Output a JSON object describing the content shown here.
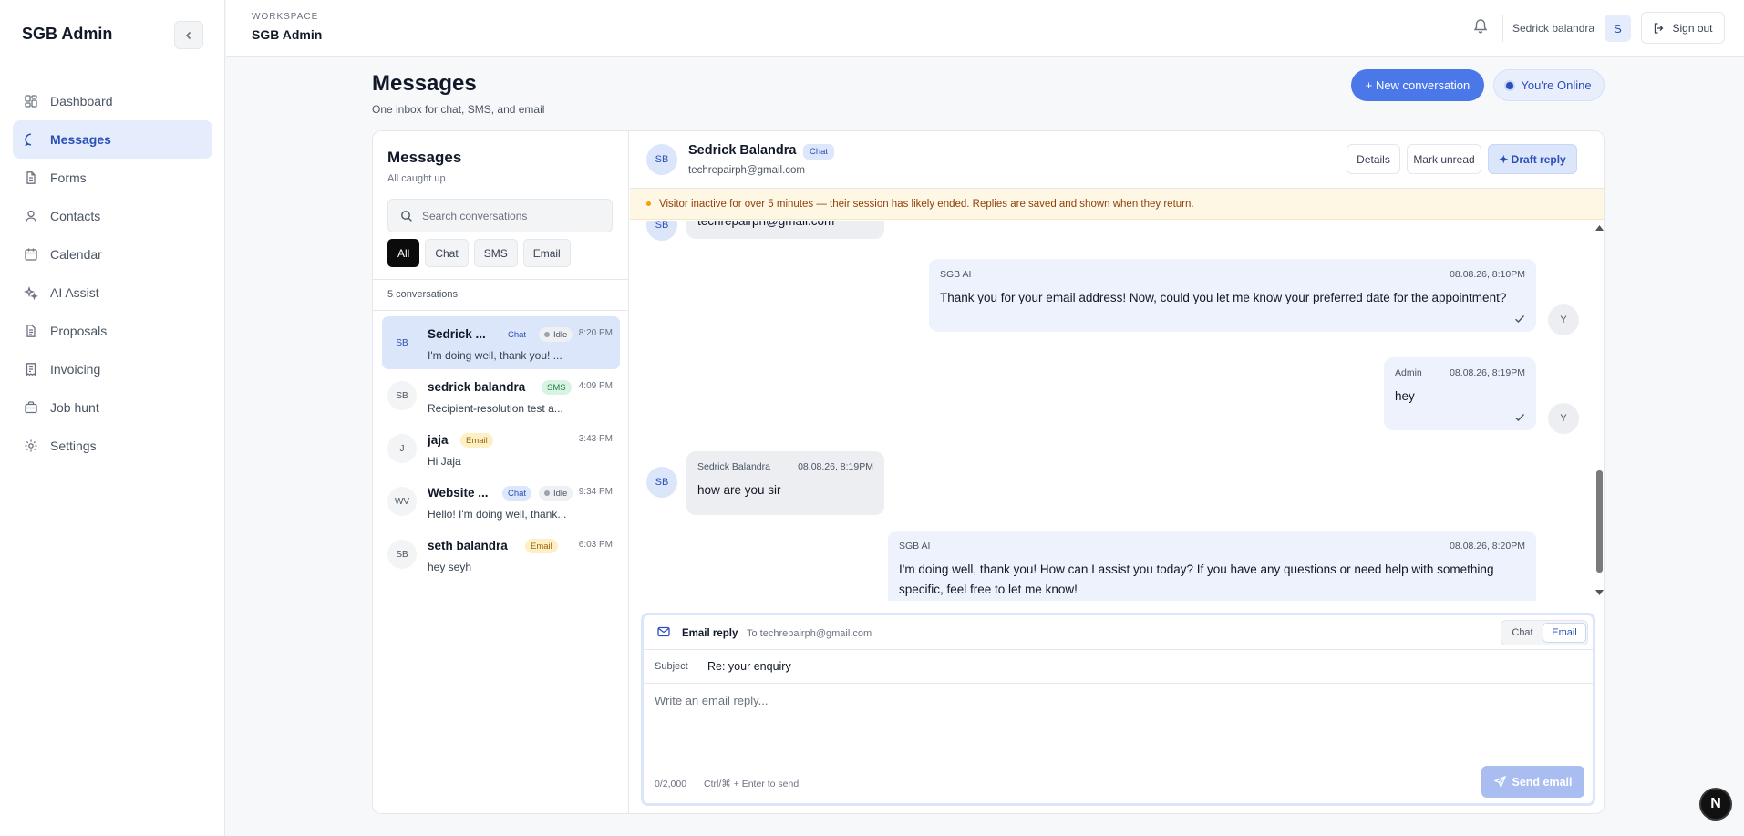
{
  "app": {
    "brand": "SGB Admin"
  },
  "sidebar": {
    "items": [
      {
        "label": "Dashboard",
        "icon": "dashboard-icon"
      },
      {
        "label": "Messages",
        "icon": "chat-icon",
        "active": true
      },
      {
        "label": "Forms",
        "icon": "file-icon"
      },
      {
        "label": "Contacts",
        "icon": "user-icon"
      },
      {
        "label": "Calendar",
        "icon": "calendar-icon"
      },
      {
        "label": "AI Assist",
        "icon": "sparkle-icon"
      },
      {
        "label": "Proposals",
        "icon": "document-icon"
      },
      {
        "label": "Invoicing",
        "icon": "receipt-icon"
      },
      {
        "label": "Job hunt",
        "icon": "briefcase-icon"
      },
      {
        "label": "Settings",
        "icon": "gear-icon"
      }
    ]
  },
  "topbar": {
    "workspace_label": "WORKSPACE",
    "workspace_name": "SGB Admin",
    "user_name": "Sedrick balandra",
    "user_initial": "S",
    "signout_label": "Sign out"
  },
  "page": {
    "title": "Messages",
    "subtitle": "One inbox for chat, SMS, and email",
    "new_conversation_label": "+ New conversation",
    "online_label": "You're Online"
  },
  "list": {
    "title": "Messages",
    "subtitle": "All caught up",
    "search_placeholder": "Search conversations",
    "filters": [
      "All",
      "Chat",
      "SMS",
      "Email"
    ],
    "count_label": "5 conversations",
    "conversations": [
      {
        "initials": "SB",
        "name": "Sedrick ...",
        "channel": "Chat",
        "status": "Idle",
        "time": "8:20 PM",
        "preview": "I'm doing well, thank you! ..."
      },
      {
        "initials": "SB",
        "name": "sedrick balandra",
        "channel": "SMS",
        "time": "4:09 PM",
        "preview": "Recipient-resolution test a..."
      },
      {
        "initials": "J",
        "name": "jaja",
        "channel": "Email",
        "time": "3:43 PM",
        "preview": "Hi Jaja"
      },
      {
        "initials": "WV",
        "name": "Website ...",
        "channel": "Chat",
        "status": "Idle",
        "time": "9:34 PM",
        "preview": "Hello! I'm doing well, thank..."
      },
      {
        "initials": "SB",
        "name": "seth balandra",
        "channel": "Email",
        "time": "6:03 PM",
        "preview": "hey seyh"
      }
    ]
  },
  "thread": {
    "initials": "SB",
    "name": "Sedrick Balandra",
    "channel": "Chat",
    "email": "techrepairph@gmail.com",
    "details_label": "Details",
    "mark_unread_label": "Mark unread",
    "draft_reply_label": "✦ Draft reply",
    "warning": "Visitor inactive for over 5 minutes — their session has likely ended. Replies are saved and shown when they return.",
    "messages": [
      {
        "text": "techrepairph@gmail.com"
      },
      {
        "sender": "SGB AI",
        "time": "08.08.26, 8:10PM",
        "text": "Thank you for your email address! Now, could you let me know your preferred date for the appointment?",
        "avatar": "Y"
      },
      {
        "sender": "Admin",
        "time": "08.08.26, 8:19PM",
        "text": "hey",
        "avatar": "Y"
      },
      {
        "sender": "Sedrick Balandra",
        "time": "08.08.26, 8:19PM",
        "text": "how are you sir",
        "avatar": "SB"
      },
      {
        "sender": "SGB AI",
        "time": "08.08.26, 8:20PM",
        "text": "I'm doing well, thank you! How can I assist you today? If you have any questions or need help with something specific, feel free to let me know!"
      }
    ]
  },
  "compose": {
    "title": "Email reply",
    "to": "To techrepairph@gmail.com",
    "modes": [
      "Chat",
      "Email"
    ],
    "active_mode": "Email",
    "subject_label": "Subject",
    "subject": "Re: your enquiry",
    "body_placeholder": "Write an email reply...",
    "char_count": "0/2,000",
    "hint": "Ctrl/⌘ + Enter to send",
    "send_label": "Send email"
  },
  "fab": {
    "label": "N"
  }
}
